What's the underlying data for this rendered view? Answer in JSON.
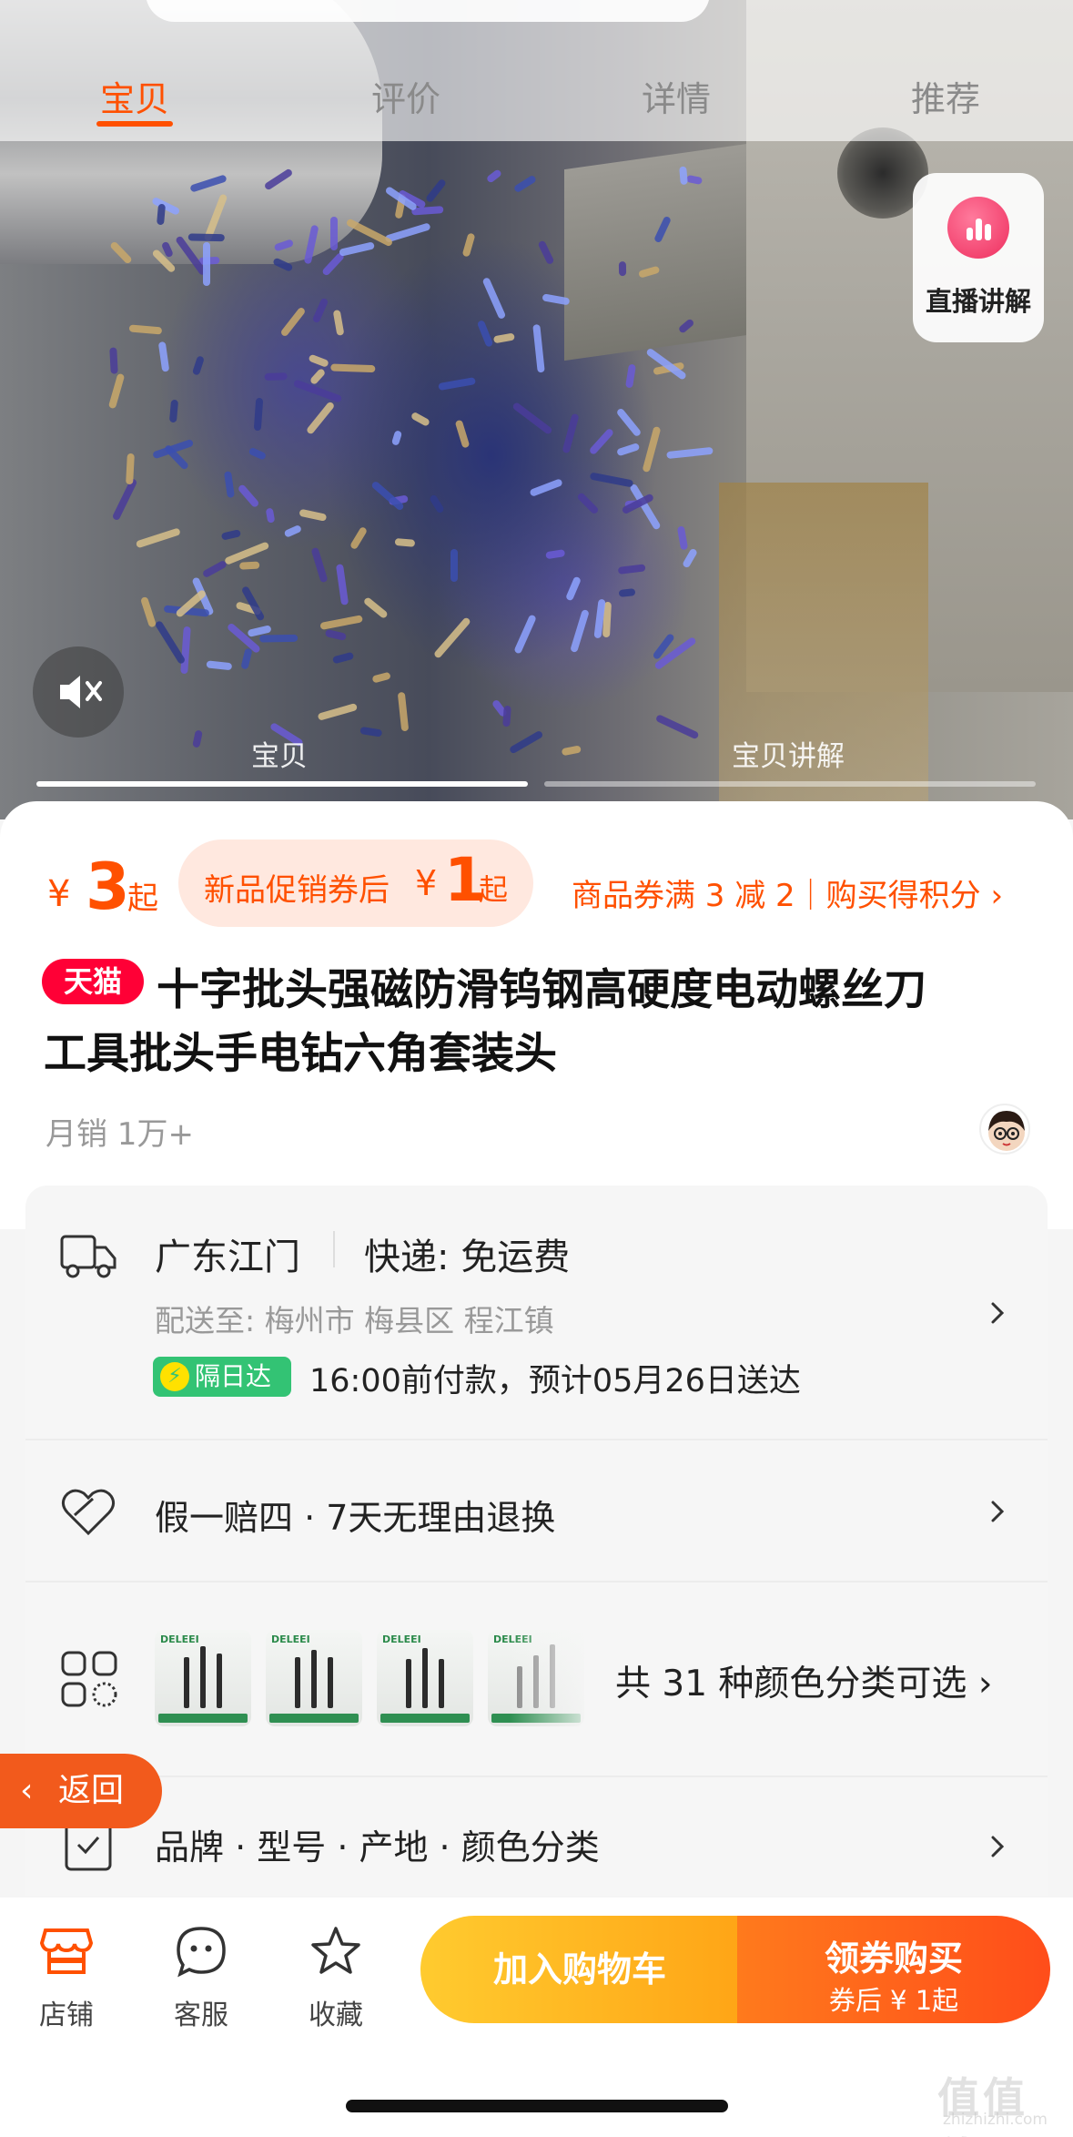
{
  "top_tabs": [
    "宝贝",
    "评价",
    "详情",
    "推荐"
  ],
  "live_button": {
    "label": "直播讲解"
  },
  "media_tabs": [
    "宝贝",
    "宝贝讲解"
  ],
  "price": {
    "currency": "¥",
    "value": "3",
    "suffix": "起"
  },
  "promo": {
    "label": "新品促销券后",
    "currency": "¥",
    "value": "1",
    "suffix": "起"
  },
  "coupon_link": "商品券满 3 减 2｜购买得积分 ›",
  "product": {
    "badge": "天猫",
    "title_line1": "十字批头强磁防滑钨钢高硬度电动螺丝刀",
    "title_line2": "工具批头手电钻六角套装头",
    "monthly_sales": "月销 1万+"
  },
  "shipping": {
    "origin": "广东江门",
    "method": "快递: 免运费",
    "deliver_to": "配送至: 梅州市 梅县区 程江镇",
    "badge": "隔日达",
    "eta": "16:00前付款，预计05月26日送达"
  },
  "guarantee": "假一赔四 · 7天无理由退换",
  "sku": {
    "summary": "共 31 种颜色分类可选 ›",
    "thumb_brand": "DELEEI"
  },
  "attributes": "品牌 · 型号 · 产地 · 颜色分类",
  "back_button": "返回",
  "bottom_bar": {
    "shop": "店铺",
    "service": "客服",
    "favorite": "收藏",
    "add_to_cart": "加入购物车",
    "buy_main": "领券购买",
    "buy_sub": "券后 ¥ 1起"
  },
  "watermark": {
    "main": "值值值",
    "sub": "zhizhizhi.com"
  },
  "colors": {
    "accent": "#ff5000",
    "tmall": "#ff0036",
    "green": "#33c374"
  }
}
